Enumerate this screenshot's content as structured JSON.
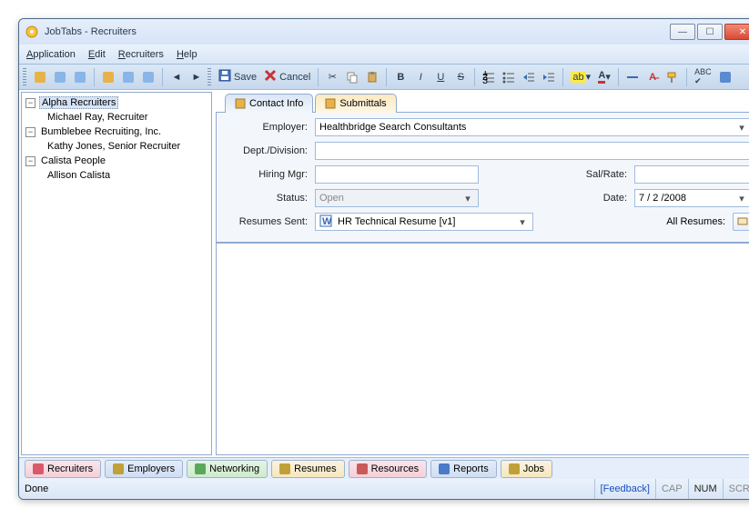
{
  "window": {
    "title": "JobTabs - Recruiters"
  },
  "menu": {
    "application": "Application",
    "edit": "Edit",
    "recruiters": "Recruiters",
    "help": "Help"
  },
  "toolbar": {
    "save": "Save",
    "cancel": "Cancel"
  },
  "tree": {
    "nodes": [
      {
        "label": "Alpha Recruiters",
        "children": [
          "Michael Ray, Recruiter"
        ]
      },
      {
        "label": "Bumblebee Recruiting, Inc.",
        "children": [
          "Kathy Jones, Senior Recruiter"
        ]
      },
      {
        "label": "Calista People",
        "children": [
          "Allison Calista"
        ]
      }
    ]
  },
  "tabs": {
    "contact": "Contact Info",
    "submittals": "Submittals"
  },
  "form": {
    "employer_label": "Employer:",
    "employer_value": "Healthbridge Search Consultants",
    "dept_label": "Dept./Division:",
    "dept_value": "",
    "hiring_label": "Hiring Mgr:",
    "hiring_value": "",
    "salrate_label": "Sal/Rate:",
    "salrate_value": "",
    "status_label": "Status:",
    "status_value": "Open",
    "date_label": "Date:",
    "date_value": "7 / 2 /2008",
    "resumes_label": "Resumes Sent:",
    "resumes_value": "HR Technical Resume [v1]",
    "all_resumes_label": "All Resumes:"
  },
  "bottom_tabs": {
    "recruiters": "Recruiters",
    "employers": "Employers",
    "networking": "Networking",
    "resumes": "Resumes",
    "resources": "Resources",
    "reports": "Reports",
    "jobs": "Jobs"
  },
  "status": {
    "done": "Done",
    "feedback": "[Feedback]",
    "cap": "CAP",
    "num": "NUM",
    "scrl": "SCRL"
  }
}
